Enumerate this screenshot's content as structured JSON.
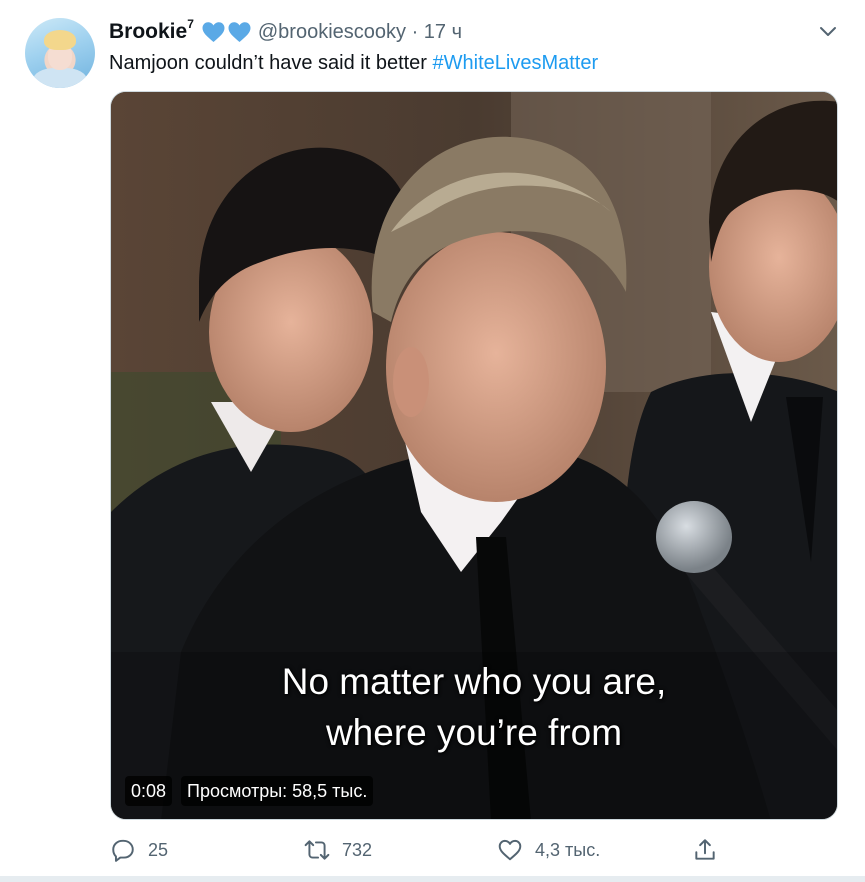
{
  "tweet": {
    "display_name": "Brookie",
    "name_superscript": "7",
    "hearts": [
      "blue-heart-icon",
      "blue-heart-icon"
    ],
    "handle_time": "@brookiescooky · 17 ч",
    "text": "Namjoon couldn’t have said it better ",
    "hashtag": "#WhiteLivesMatter",
    "avatar": "user-avatar",
    "menu": "chevron-down-icon"
  },
  "media": {
    "subtitle_line1": "No matter who you are,",
    "subtitle_line2": "where you’re from",
    "time": "0:08",
    "views": "Просмотры: 58,5 тыс."
  },
  "actions": {
    "reply_count": "25",
    "retweet_count": "732",
    "like_count": "4,3 тыс.",
    "icons": [
      "reply-icon",
      "retweet-icon",
      "like-icon",
      "share-icon"
    ]
  },
  "colors": {
    "accent": "#1d9bf0",
    "muted_text": "#536471",
    "heart_blue": "#5aa9e6"
  }
}
